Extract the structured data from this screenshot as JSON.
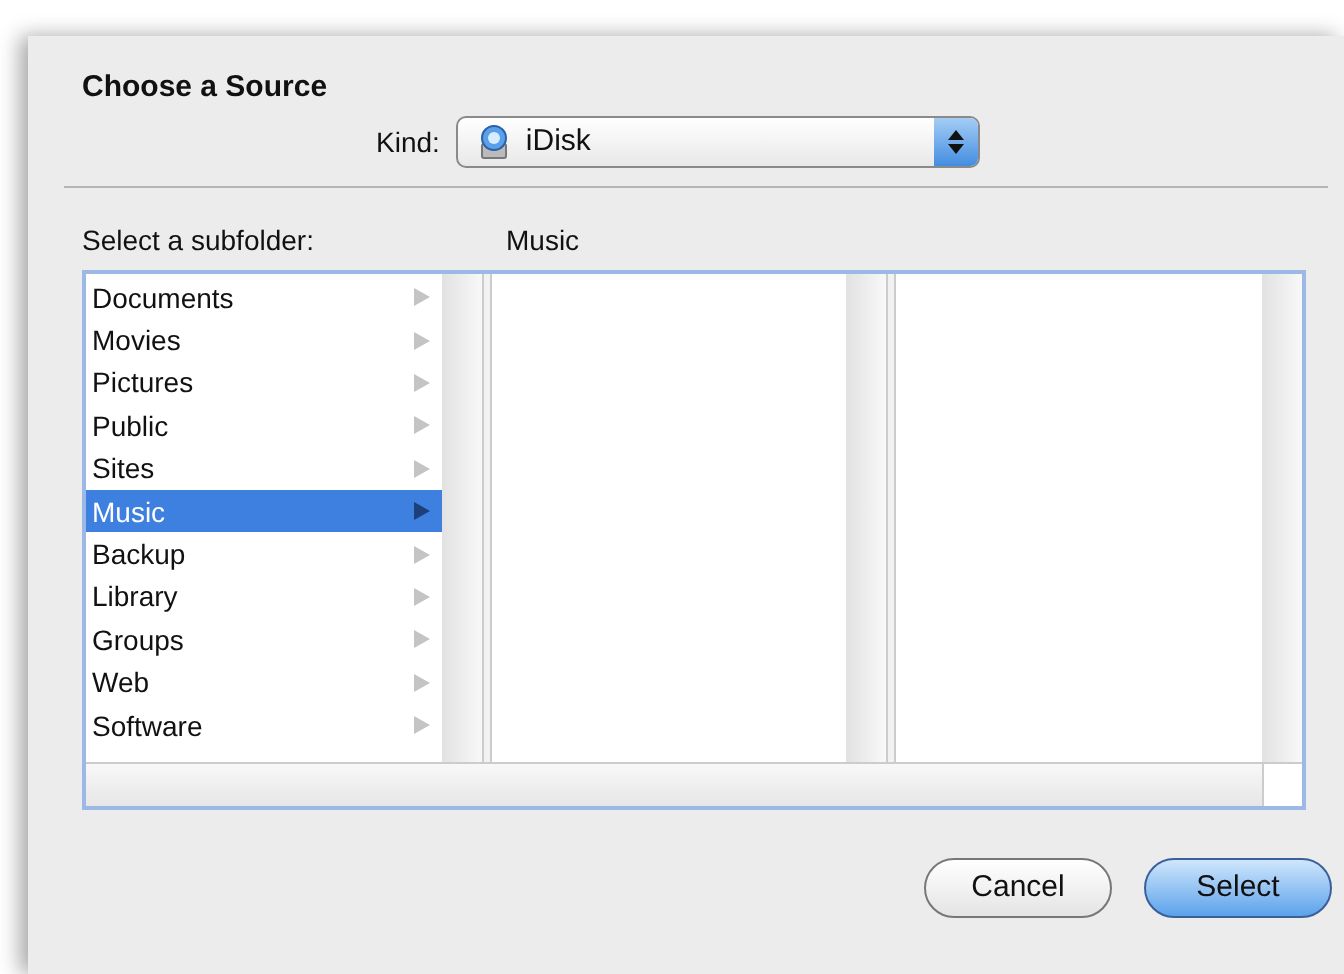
{
  "sheet": {
    "title": "Choose a Source"
  },
  "kind": {
    "label": "Kind:",
    "value": "iDisk"
  },
  "browser": {
    "label": "Select a subfolder:",
    "path_label": "Music",
    "items": [
      {
        "name": "Documents",
        "selected": false
      },
      {
        "name": "Movies",
        "selected": false
      },
      {
        "name": "Pictures",
        "selected": false
      },
      {
        "name": "Public",
        "selected": false
      },
      {
        "name": "Sites",
        "selected": false
      },
      {
        "name": "Music",
        "selected": true
      },
      {
        "name": "Backup",
        "selected": false
      },
      {
        "name": "Library",
        "selected": false
      },
      {
        "name": "Groups",
        "selected": false
      },
      {
        "name": "Web",
        "selected": false
      },
      {
        "name": "Software",
        "selected": false
      }
    ]
  },
  "buttons": [
    {
      "label": "Cancel",
      "kind": "normal"
    },
    {
      "label": "Select",
      "kind": "default"
    }
  ]
}
